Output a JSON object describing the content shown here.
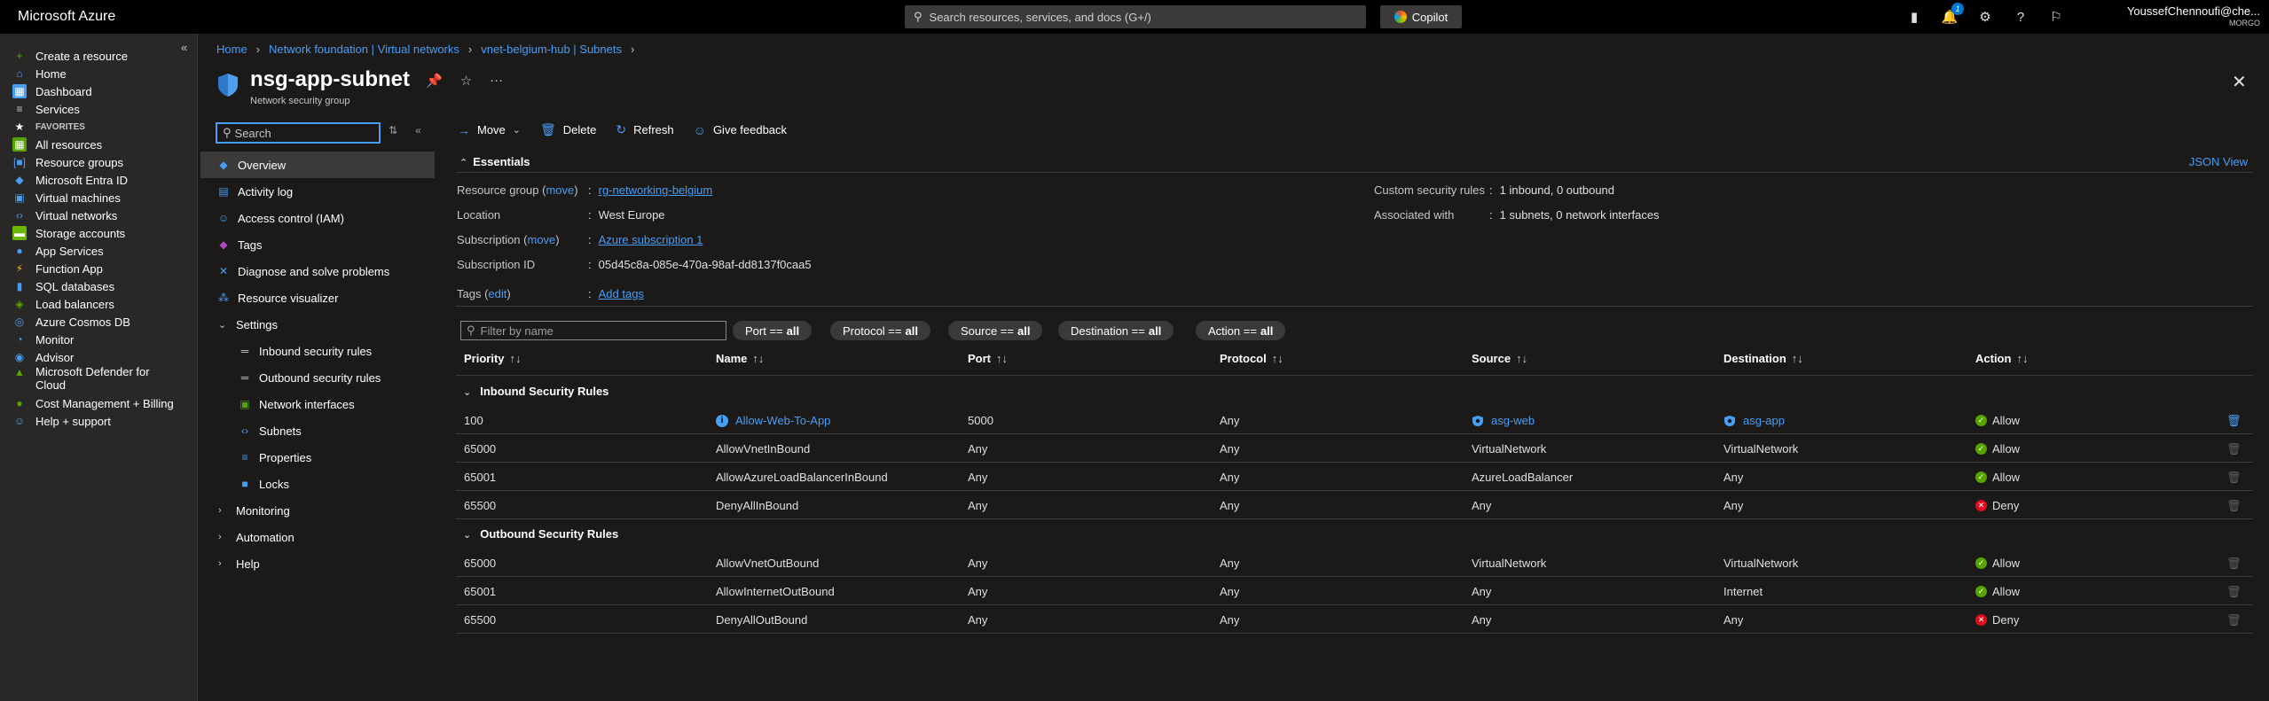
{
  "topbar": {
    "brand": "Microsoft Azure",
    "search_placeholder": "Search resources, services, and docs (G+/)",
    "copilot": "Copilot",
    "notifications_count": "1",
    "user_name": "YoussefChennoufi@che...",
    "user_tenant": "MORGO"
  },
  "leftnav": {
    "items": [
      {
        "label": "Create a resource",
        "icon": "plus-icon"
      },
      {
        "label": "Home",
        "icon": "home-icon"
      },
      {
        "label": "Dashboard",
        "icon": "dashboard-icon"
      },
      {
        "label": "Services",
        "icon": "services-icon"
      },
      {
        "label": "FAVORITES",
        "icon": "star-icon"
      },
      {
        "label": "All resources",
        "icon": "all-resources-icon"
      },
      {
        "label": "Resource groups",
        "icon": "resource-groups-icon"
      },
      {
        "label": "Microsoft Entra ID",
        "icon": "entra-id-icon"
      },
      {
        "label": "Virtual machines",
        "icon": "virtual-machines-icon"
      },
      {
        "label": "Virtual networks",
        "icon": "virtual-networks-icon"
      },
      {
        "label": "Storage accounts",
        "icon": "storage-accounts-icon"
      },
      {
        "label": "App Services",
        "icon": "app-services-icon"
      },
      {
        "label": "Function App",
        "icon": "function-app-icon"
      },
      {
        "label": "SQL databases",
        "icon": "sql-databases-icon"
      },
      {
        "label": "Load balancers",
        "icon": "load-balancers-icon"
      },
      {
        "label": "Azure Cosmos DB",
        "icon": "cosmos-db-icon"
      },
      {
        "label": "Monitor",
        "icon": "monitor-icon"
      },
      {
        "label": "Advisor",
        "icon": "advisor-icon"
      },
      {
        "label": "Microsoft Defender for",
        "label2": "Cloud",
        "icon": "defender-icon"
      },
      {
        "label": "Cost Management + Billing",
        "icon": "cost-management-icon"
      },
      {
        "label": "Help + support",
        "icon": "help-support-icon"
      }
    ]
  },
  "breadcrumb": {
    "items": [
      "Home",
      "Network foundation | Virtual networks",
      "vnet-belgium-hub | Subnets"
    ]
  },
  "resource": {
    "title": "nsg-app-subnet",
    "subtitle": "Network security group"
  },
  "resource_menu": {
    "search_placeholder": "Search",
    "items": [
      {
        "label": "Overview",
        "icon": "overview-shield-icon"
      },
      {
        "label": "Activity log",
        "icon": "activity-log-icon"
      },
      {
        "label": "Access control (IAM)",
        "icon": "iam-icon"
      },
      {
        "label": "Tags",
        "icon": "tags-icon"
      },
      {
        "label": "Diagnose and solve problems",
        "icon": "diagnose-icon"
      },
      {
        "label": "Resource visualizer",
        "icon": "visualizer-icon"
      },
      {
        "label": "Settings",
        "icon": "chevron-down-icon"
      },
      {
        "label": "Inbound security rules",
        "icon": "inbound-rules-icon"
      },
      {
        "label": "Outbound security rules",
        "icon": "outbound-rules-icon"
      },
      {
        "label": "Network interfaces",
        "icon": "network-interfaces-icon"
      },
      {
        "label": "Subnets",
        "icon": "subnets-icon"
      },
      {
        "label": "Properties",
        "icon": "properties-icon"
      },
      {
        "label": "Locks",
        "icon": "locks-icon"
      },
      {
        "label": "Monitoring",
        "icon": "chevron-right-icon"
      },
      {
        "label": "Automation",
        "icon": "chevron-right-icon"
      },
      {
        "label": "Help",
        "icon": "chevron-right-icon"
      }
    ]
  },
  "toolbar": {
    "move": "Move",
    "delete": "Delete",
    "refresh": "Refresh",
    "feedback": "Give feedback"
  },
  "essentials": {
    "title": "Essentials",
    "json_view": "JSON View",
    "resource_group_label": "Resource group",
    "move_link": "move",
    "resource_group_value": "rg-networking-belgium",
    "location_label": "Location",
    "location_value": "West Europe",
    "subscription_label": "Subscription",
    "subscription_value": "Azure subscription 1",
    "subscription_id_label": "Subscription ID",
    "subscription_id_value": "05d45c8a-085e-470a-98af-dd8137f0caa5",
    "custom_rules_label": "Custom security rules",
    "custom_rules_value": "1 inbound, 0 outbound",
    "associated_label": "Associated with",
    "associated_value": "1 subnets, 0 network interfaces",
    "tags_label": "Tags",
    "edit_link": "edit",
    "add_tags": "Add tags"
  },
  "filters": {
    "placeholder": "Filter by name",
    "pills": [
      {
        "key": "Port ==",
        "value": "all"
      },
      {
        "key": "Protocol ==",
        "value": "all"
      },
      {
        "key": "Source ==",
        "value": "all"
      },
      {
        "key": "Destination ==",
        "value": "all"
      },
      {
        "key": "Action ==",
        "value": "all"
      }
    ]
  },
  "table": {
    "columns": [
      "Priority",
      "Name",
      "Port",
      "Protocol",
      "Source",
      "Destination",
      "Action"
    ],
    "sort_glyph": "↑↓",
    "inbound_title": "Inbound Security Rules",
    "outbound_title": "Outbound Security Rules",
    "inbound": [
      {
        "priority": "100",
        "name": "Allow-Web-To-App",
        "port": "5000",
        "protocol": "Any",
        "source": "asg-web",
        "destination": "asg-app",
        "action": "Allow"
      },
      {
        "priority": "65000",
        "name": "AllowVnetInBound",
        "port": "Any",
        "protocol": "Any",
        "source": "VirtualNetwork",
        "destination": "VirtualNetwork",
        "action": "Allow"
      },
      {
        "priority": "65001",
        "name": "AllowAzureLoadBalancerInBound",
        "port": "Any",
        "protocol": "Any",
        "source": "AzureLoadBalancer",
        "destination": "Any",
        "action": "Allow"
      },
      {
        "priority": "65500",
        "name": "DenyAllInBound",
        "port": "Any",
        "protocol": "Any",
        "source": "Any",
        "destination": "Any",
        "action": "Deny"
      }
    ],
    "outbound": [
      {
        "priority": "65000",
        "name": "AllowVnetOutBound",
        "port": "Any",
        "protocol": "Any",
        "source": "VirtualNetwork",
        "destination": "VirtualNetwork",
        "action": "Allow"
      },
      {
        "priority": "65001",
        "name": "AllowInternetOutBound",
        "port": "Any",
        "protocol": "Any",
        "source": "Any",
        "destination": "Internet",
        "action": "Allow"
      },
      {
        "priority": "65500",
        "name": "DenyAllOutBound",
        "port": "Any",
        "protocol": "Any",
        "source": "Any",
        "destination": "Any",
        "action": "Deny"
      }
    ]
  },
  "colors": {
    "accent": "#479ef5",
    "allow": "#57a300",
    "deny": "#e00b1c"
  }
}
